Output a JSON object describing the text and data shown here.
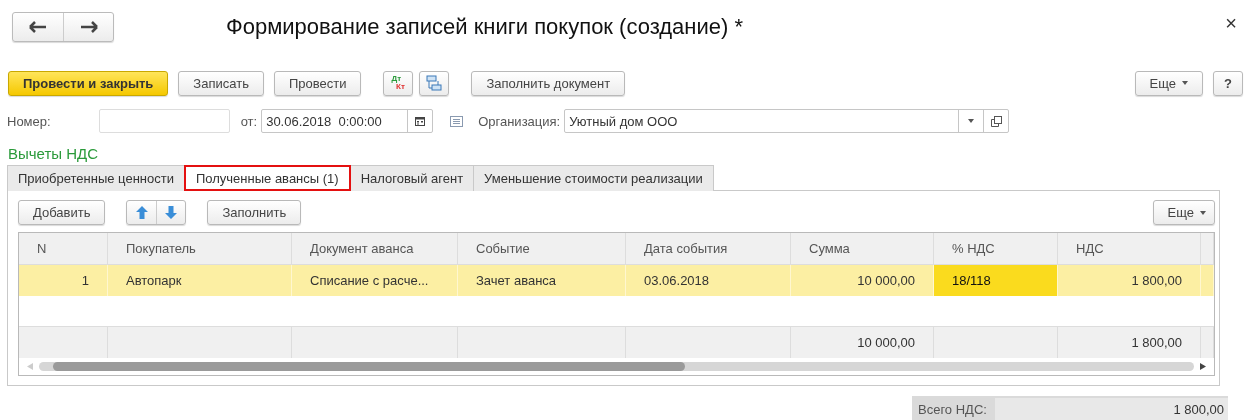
{
  "window": {
    "title": "Формирование записей книги покупок (создание) *",
    "close": "×"
  },
  "toolbar": {
    "buttons": [
      {
        "kind": "primary",
        "label": "Провести и закрыть"
      },
      {
        "kind": "plain",
        "label": "Записать"
      },
      {
        "kind": "plain",
        "label": "Провести"
      },
      {
        "kind": "dtkt",
        "top": "Дт",
        "bottom": "Кт"
      },
      {
        "kind": "structure"
      },
      {
        "kind": "plain",
        "label": "Заполнить документ"
      }
    ],
    "right": [
      {
        "kind": "menu",
        "label": "Еще"
      },
      {
        "kind": "plain",
        "label": "?"
      }
    ]
  },
  "form": {
    "number_label": "Номер:",
    "date_label": "от:",
    "date": "30.06.2018  0:00:00",
    "org_label": "Организация:",
    "org": "Уютный дом ООО"
  },
  "section": "Вычеты НДС",
  "tabs": [
    {
      "label": "Приобретенные ценности",
      "selected": false
    },
    {
      "label": "Полученные авансы (1)",
      "selected": true
    },
    {
      "label": "Налоговый агент",
      "selected": false
    },
    {
      "label": "Уменьшение стоимости реализации",
      "selected": false
    }
  ],
  "table_toolbar": {
    "add": "Добавить",
    "fill": "Заполнить",
    "more": "Еще"
  },
  "table": {
    "columns": [
      {
        "title": "N",
        "kind": "number"
      },
      {
        "title": "Покупатель",
        "kind": "text"
      },
      {
        "title": "Документ аванса",
        "kind": "text"
      },
      {
        "title": "Событие",
        "kind": "text"
      },
      {
        "title": "Дата события",
        "kind": "text"
      },
      {
        "title": "Сумма",
        "kind": "number",
        "total": "10 000,00"
      },
      {
        "title": "% НДС",
        "kind": "text"
      },
      {
        "title": "НДС",
        "kind": "number",
        "total": "1 800,00"
      }
    ],
    "rows": [
      {
        "selected": true,
        "cells": [
          {
            "text": "1",
            "selected": false
          },
          {
            "text": "Автопарк",
            "selected": false
          },
          {
            "text": "Списание с расче...",
            "selected": false
          },
          {
            "text": "Зачет аванса",
            "selected": false
          },
          {
            "text": "03.06.2018",
            "selected": false
          },
          {
            "text": "10 000,00",
            "selected": false
          },
          {
            "text": "18/118",
            "selected": true
          },
          {
            "text": "1 800,00",
            "selected": false
          }
        ]
      }
    ]
  },
  "totals": {
    "label": "Всего НДС:",
    "value": "1 800,00"
  }
}
